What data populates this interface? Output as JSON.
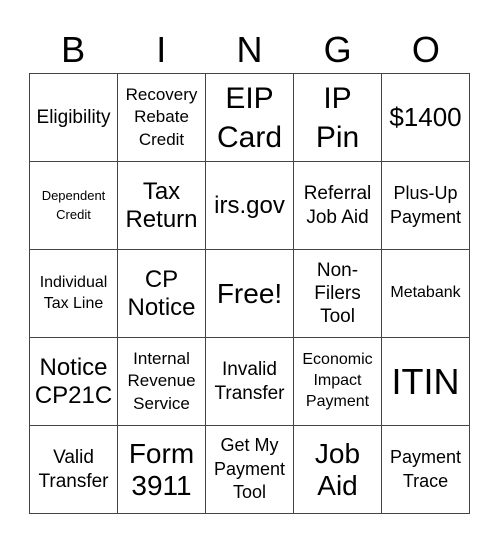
{
  "header": {
    "letters": [
      "B",
      "I",
      "N",
      "G",
      "O"
    ]
  },
  "card": {
    "cells": [
      {
        "text": "Eligibility",
        "size": "s19"
      },
      {
        "text": "Recovery\nRebate\nCredit",
        "size": "s17"
      },
      {
        "text": "EIP\nCard",
        "size": "s30"
      },
      {
        "text": "IP\nPin",
        "size": "s30"
      },
      {
        "text": "$1400",
        "size": "s26"
      },
      {
        "text": "Dependent\nCredit",
        "size": "s13"
      },
      {
        "text": "Tax\nReturn",
        "size": "s24"
      },
      {
        "text": "irs.gov",
        "size": "s24"
      },
      {
        "text": "Referral\nJob Aid",
        "size": "s19"
      },
      {
        "text": "Plus-Up\nPayment",
        "size": "s18"
      },
      {
        "text": "Individual\nTax Line",
        "size": "s16"
      },
      {
        "text": "CP\nNotice",
        "size": "s24"
      },
      {
        "text": "Free!",
        "size": "s28"
      },
      {
        "text": "Non-\nFilers\nTool",
        "size": "s19"
      },
      {
        "text": "Metabank",
        "size": "s16"
      },
      {
        "text": "Notice\nCP21C",
        "size": "s24"
      },
      {
        "text": "Internal\nRevenue\nService",
        "size": "s17"
      },
      {
        "text": "Invalid\nTransfer",
        "size": "s19"
      },
      {
        "text": "Economic\nImpact\nPayment",
        "size": "s16"
      },
      {
        "text": "ITIN",
        "size": "s36"
      },
      {
        "text": "Valid\nTransfer",
        "size": "s19"
      },
      {
        "text": "Form\n3911",
        "size": "s28"
      },
      {
        "text": "Get My\nPayment\nTool",
        "size": "s18"
      },
      {
        "text": "Job\nAid",
        "size": "s28"
      },
      {
        "text": "Payment\nTrace",
        "size": "s18"
      }
    ]
  }
}
